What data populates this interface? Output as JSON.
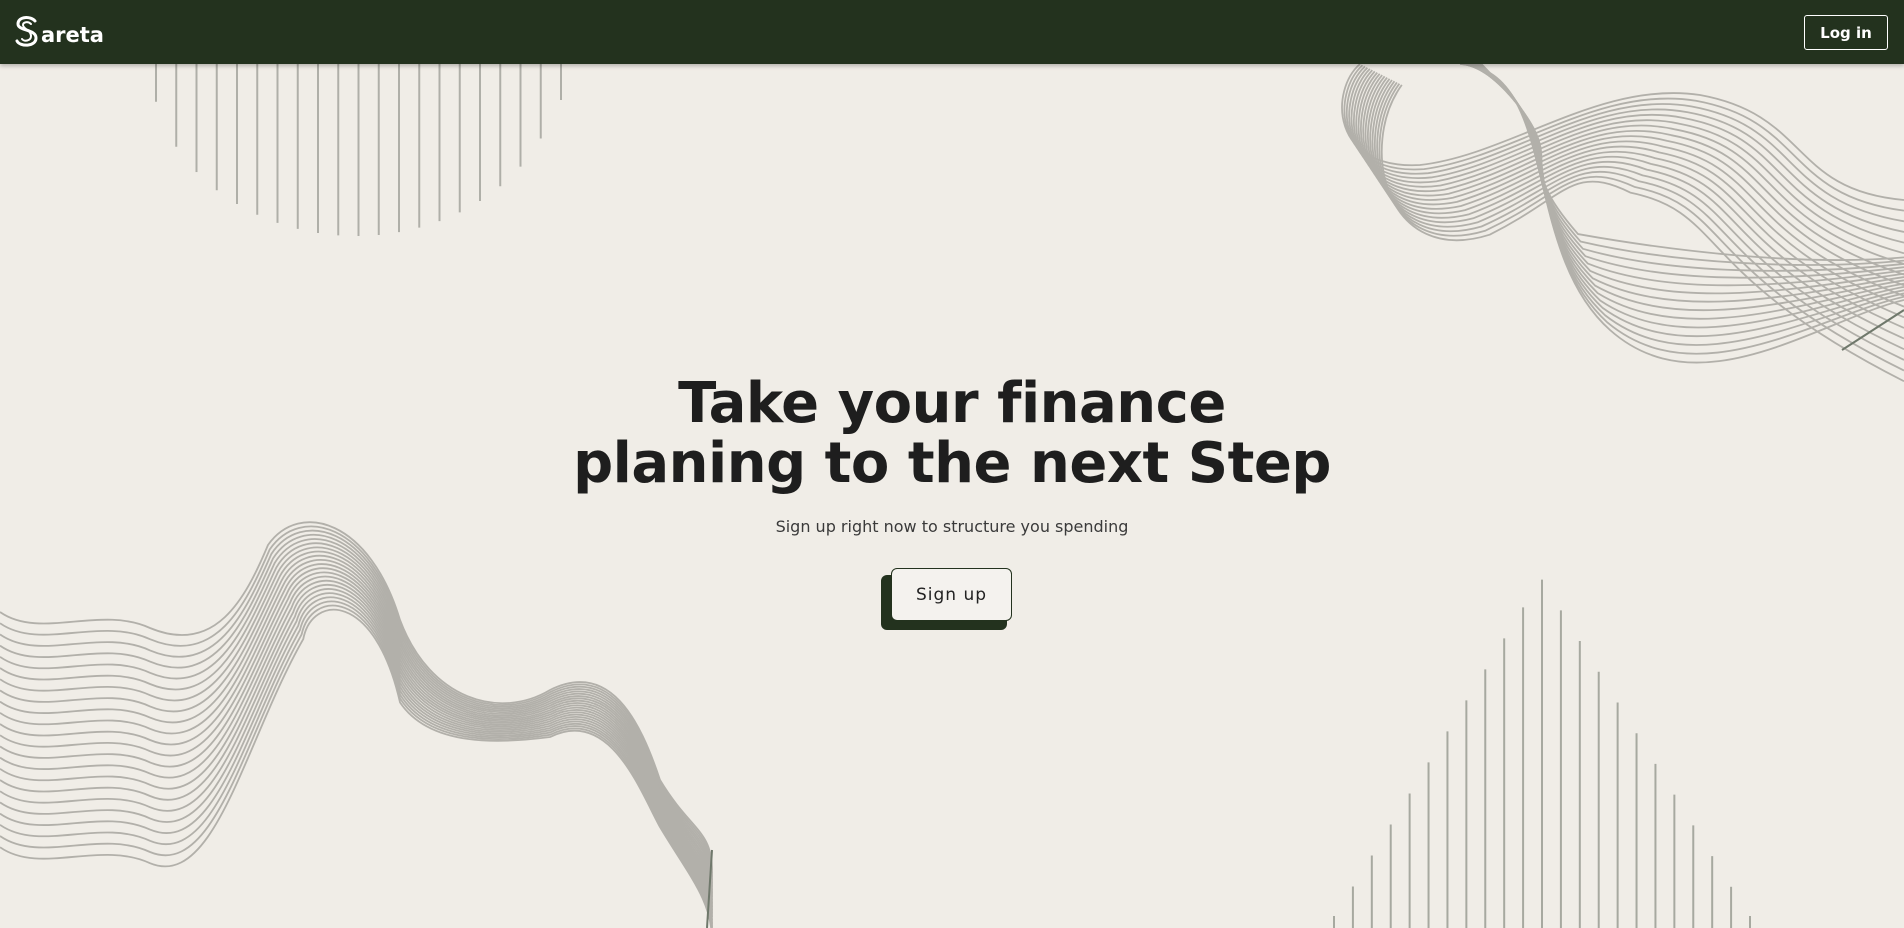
{
  "colors": {
    "nav_background": "#23321e",
    "page_background": "#f0ede7",
    "decor_line": "#afafa8",
    "text_dark": "#1e1e1e"
  },
  "header": {
    "logo_text": "areta",
    "login_label": "Log in"
  },
  "hero": {
    "title_line1": "Take your finance",
    "title_line2": "planing to the next Step",
    "subtitle": "Sign up right now to structure you spending",
    "cta_label": "Sign up"
  },
  "icons": {
    "logo": "sareta-s-logo-icon"
  }
}
